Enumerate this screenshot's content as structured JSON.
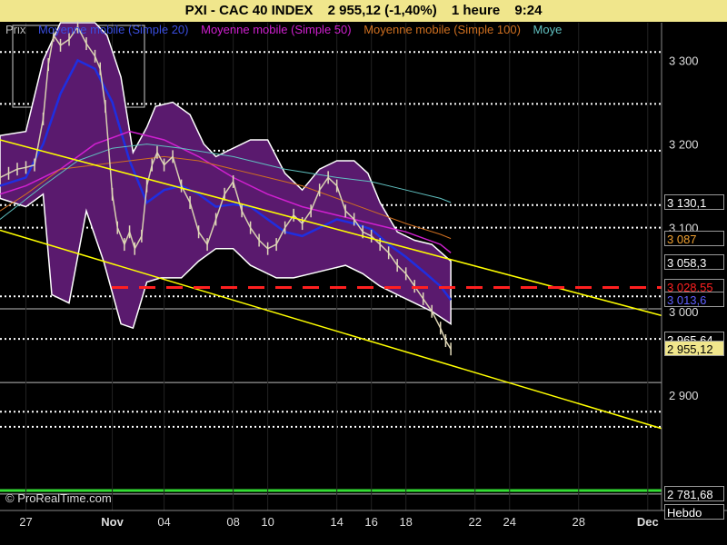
{
  "header": {
    "symbol": "PXI - CAC 40 INDEX",
    "price_change": "2 955,12 (-1,40%)",
    "timeframe": "1 heure",
    "time": "9:24"
  },
  "legend": {
    "prix": "Prix",
    "ma20": "Moyenne mobile (Simple 20)",
    "ma50": "Moyenne mobile (Simple 50)",
    "ma100": "Moyenne mobile (Simple 100)",
    "ma_cut": "Moye"
  },
  "watermark": "© ProRealTime.com",
  "colors": {
    "header_bg": "#f0e68c",
    "band": "#5a1a6e",
    "ma20": "#1f2ee0",
    "ma50": "#d020d0",
    "ma100": "#d07020",
    "ma200": "#60c0c0",
    "trend": "#ffff00",
    "support": "#ff2020"
  },
  "price_boxes": [
    {
      "label": "3 130,1",
      "value": 3130.1,
      "bg": "#000000",
      "fg": "#ffffff"
    },
    {
      "label": "3 087",
      "value": 3087,
      "bg": "#000000",
      "fg": "#f0a030"
    },
    {
      "label": "3 058,3",
      "value": 3058.3,
      "bg": "#000000",
      "fg": "#ffffff"
    },
    {
      "label": "3 028,55",
      "value": 3028.55,
      "bg": "#000000",
      "fg": "#ff2020"
    },
    {
      "label": "3 013,6",
      "value": 3013.6,
      "bg": "#000000",
      "fg": "#6060ff"
    },
    {
      "label": "2 965,64",
      "value": 2965.64,
      "bg": "#000000",
      "fg": "#ffffff"
    },
    {
      "label": "2 955,12",
      "value": 2955.12,
      "bg": "#f0e68c",
      "fg": "#000000"
    },
    {
      "label": "2 781,68",
      "value": 2781.68,
      "bg": "#000000",
      "fg": "#ffffff"
    },
    {
      "label": "Hebdo",
      "value": 2760,
      "bg": "#000000",
      "fg": "#ffffff"
    }
  ],
  "chart_data": {
    "type": "line",
    "title": "PXI - CAC 40 INDEX",
    "xlabel": "",
    "ylabel": "",
    "ylim": [
      2762,
      3345
    ],
    "y_ticks": [
      {
        "label": "3 300",
        "value": 3300
      },
      {
        "label": "3 200",
        "value": 3200
      },
      {
        "label": "3 100",
        "value": 3100
      },
      {
        "label": "3 000",
        "value": 3000
      },
      {
        "label": "2 900",
        "value": 2900
      }
    ],
    "x_ticks": [
      "27",
      "Nov",
      "04",
      "08",
      "10",
      "14",
      "16",
      "18",
      "22",
      "24",
      "28",
      "Dec"
    ],
    "x_tick_day": [
      -4,
      1,
      4,
      8,
      10,
      14,
      16,
      18,
      22,
      24,
      28,
      32
    ],
    "price": [
      [
        -5.5,
        3160
      ],
      [
        -5,
        3165
      ],
      [
        -4.5,
        3170
      ],
      [
        -4,
        3172
      ],
      [
        -3.5,
        3175
      ],
      [
        -3,
        3230
      ],
      [
        -2.7,
        3295
      ],
      [
        -2.4,
        3330
      ],
      [
        -2,
        3318
      ],
      [
        -1.5,
        3325
      ],
      [
        -1,
        3340
      ],
      [
        -0.5,
        3320
      ],
      [
        0,
        3305
      ],
      [
        0.3,
        3290
      ],
      [
        0.6,
        3245
      ],
      [
        1,
        3140
      ],
      [
        1.3,
        3100
      ],
      [
        1.7,
        3080
      ],
      [
        2,
        3095
      ],
      [
        2.3,
        3075
      ],
      [
        2.7,
        3090
      ],
      [
        3,
        3150
      ],
      [
        3.3,
        3175
      ],
      [
        3.6,
        3190
      ],
      [
        4,
        3175
      ],
      [
        4.5,
        3185
      ],
      [
        5,
        3150
      ],
      [
        5.5,
        3130
      ],
      [
        6,
        3095
      ],
      [
        6.5,
        3080
      ],
      [
        7,
        3110
      ],
      [
        7.5,
        3140
      ],
      [
        8,
        3155
      ],
      [
        8.5,
        3120
      ],
      [
        9,
        3100
      ],
      [
        9.5,
        3085
      ],
      [
        10,
        3075
      ],
      [
        10.5,
        3080
      ],
      [
        11,
        3100
      ],
      [
        11.5,
        3115
      ],
      [
        12,
        3105
      ],
      [
        12.5,
        3120
      ],
      [
        13,
        3145
      ],
      [
        13.5,
        3160
      ],
      [
        14,
        3150
      ],
      [
        14.5,
        3120
      ],
      [
        15,
        3110
      ],
      [
        15.5,
        3095
      ],
      [
        16,
        3090
      ],
      [
        16.5,
        3080
      ],
      [
        17,
        3070
      ],
      [
        17.5,
        3055
      ],
      [
        18,
        3045
      ],
      [
        18.5,
        3030
      ],
      [
        19,
        3015
      ],
      [
        19.5,
        3000
      ],
      [
        20,
        2980
      ],
      [
        20.3,
        2965
      ],
      [
        20.6,
        2955
      ]
    ],
    "series": [
      {
        "name": "Moyenne mobile (Simple 20)",
        "points": [
          [
            -5.5,
            3150
          ],
          [
            -4,
            3160
          ],
          [
            -3,
            3200
          ],
          [
            -2,
            3260
          ],
          [
            -1,
            3300
          ],
          [
            0,
            3290
          ],
          [
            1,
            3250
          ],
          [
            2,
            3180
          ],
          [
            3,
            3130
          ],
          [
            4,
            3145
          ],
          [
            5,
            3150
          ],
          [
            6,
            3140
          ],
          [
            7,
            3125
          ],
          [
            8,
            3128
          ],
          [
            9,
            3125
          ],
          [
            10,
            3110
          ],
          [
            11,
            3095
          ],
          [
            12,
            3090
          ],
          [
            13,
            3100
          ],
          [
            14,
            3110
          ],
          [
            15,
            3105
          ],
          [
            16,
            3098
          ],
          [
            17,
            3080
          ],
          [
            18,
            3065
          ],
          [
            19,
            3048
          ],
          [
            20,
            3030
          ],
          [
            20.6,
            3013.6
          ]
        ]
      },
      {
        "name": "Moyenne mobile (Simple 50)",
        "points": [
          [
            -5.5,
            3140
          ],
          [
            -4,
            3150
          ],
          [
            -2,
            3170
          ],
          [
            0,
            3200
          ],
          [
            2,
            3215
          ],
          [
            4,
            3205
          ],
          [
            6,
            3185
          ],
          [
            8,
            3160
          ],
          [
            10,
            3140
          ],
          [
            12,
            3125
          ],
          [
            14,
            3115
          ],
          [
            16,
            3105
          ],
          [
            18,
            3095
          ],
          [
            20,
            3080
          ],
          [
            20.6,
            3070
          ]
        ]
      },
      {
        "name": "Moyenne mobile (Simple 100)",
        "points": [
          [
            -5.5,
            3120
          ],
          [
            -4,
            3140
          ],
          [
            -2,
            3170
          ],
          [
            0,
            3175
          ],
          [
            2,
            3180
          ],
          [
            4,
            3185
          ],
          [
            6,
            3180
          ],
          [
            8,
            3170
          ],
          [
            10,
            3160
          ],
          [
            12,
            3150
          ],
          [
            14,
            3135
          ],
          [
            16,
            3120
          ],
          [
            18,
            3105
          ],
          [
            20,
            3092
          ],
          [
            20.6,
            3087
          ]
        ]
      },
      {
        "points": [
          [
            -5.5,
            3110
          ],
          [
            -3,
            3150
          ],
          [
            -1,
            3180
          ],
          [
            1,
            3195
          ],
          [
            3,
            3200
          ],
          [
            5,
            3195
          ],
          [
            8,
            3185
          ],
          [
            11,
            3170
          ],
          [
            14,
            3160
          ],
          [
            16,
            3155
          ],
          [
            18,
            3145
          ],
          [
            20,
            3135
          ],
          [
            20.6,
            3130.1
          ]
        ]
      }
    ],
    "band_upper": [
      [
        -5.5,
        3210
      ],
      [
        -4,
        3215
      ],
      [
        -3,
        3300
      ],
      [
        -2,
        3345
      ],
      [
        -1,
        3345
      ],
      [
        0,
        3345
      ],
      [
        0.7,
        3330
      ],
      [
        1.5,
        3280
      ],
      [
        2.2,
        3190
      ],
      [
        3,
        3220
      ],
      [
        3.5,
        3245
      ],
      [
        4.5,
        3250
      ],
      [
        5.5,
        3235
      ],
      [
        6.3,
        3200
      ],
      [
        7,
        3185
      ],
      [
        8,
        3195
      ],
      [
        9,
        3205
      ],
      [
        10,
        3205
      ],
      [
        11,
        3165
      ],
      [
        12,
        3145
      ],
      [
        13,
        3170
      ],
      [
        14,
        3180
      ],
      [
        15,
        3180
      ],
      [
        15.8,
        3165
      ],
      [
        16.5,
        3130
      ],
      [
        17.5,
        3095
      ],
      [
        18.5,
        3085
      ],
      [
        19.5,
        3080
      ],
      [
        20.6,
        3060
      ]
    ],
    "band_lower": [
      [
        -5.5,
        3135
      ],
      [
        -4,
        3125
      ],
      [
        -3,
        3140
      ],
      [
        -2.5,
        3020
      ],
      [
        -1.5,
        3010
      ],
      [
        -0.5,
        3120
      ],
      [
        0.5,
        3060
      ],
      [
        1.5,
        2985
      ],
      [
        2.2,
        2980
      ],
      [
        3,
        3035
      ],
      [
        3.8,
        3040
      ],
      [
        5,
        3040
      ],
      [
        6,
        3060
      ],
      [
        7,
        3075
      ],
      [
        8,
        3075
      ],
      [
        9,
        3055
      ],
      [
        10.5,
        3040
      ],
      [
        11.5,
        3040
      ],
      [
        12.5,
        3045
      ],
      [
        13.5,
        3050
      ],
      [
        14.5,
        3055
      ],
      [
        15.5,
        3045
      ],
      [
        16.5,
        3030
      ],
      [
        17.5,
        3020
      ],
      [
        18.5,
        3010
      ],
      [
        19.5,
        3000
      ],
      [
        20.6,
        2985
      ]
    ],
    "trend_line_upper": [
      [
        -5.5,
        3205
      ],
      [
        32.8,
        2995
      ]
    ],
    "trend_line_lower": [
      [
        -5.5,
        3097
      ],
      [
        32.8,
        2860
      ]
    ],
    "support_line": 3028.55,
    "horizontal_dotted": [
      3310,
      3248,
      3192,
      3127,
      3100,
      3018,
      2967,
      2880,
      2862
    ],
    "horizontal_solid": [
      3003,
      2915,
      2781.68
    ],
    "grid": true,
    "legend_position": "top-left"
  }
}
